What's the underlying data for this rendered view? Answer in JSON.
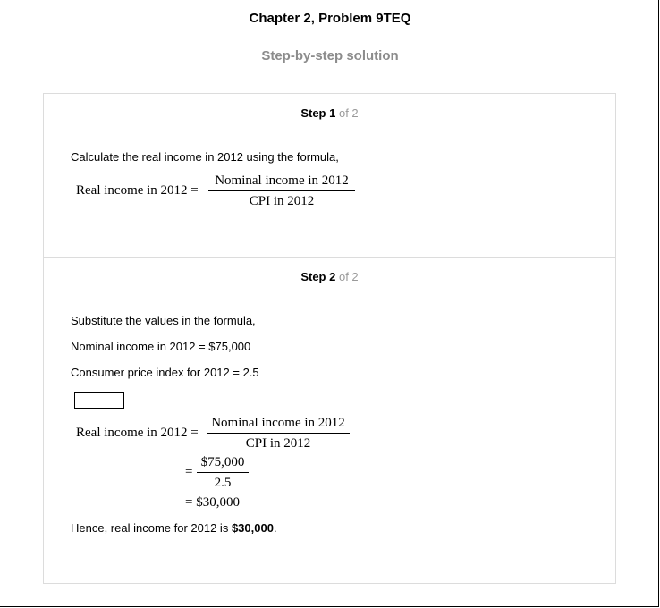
{
  "header": {
    "title": "Chapter 2, Problem 9TEQ",
    "subtitle": "Step-by-step solution"
  },
  "steps": [
    {
      "step_word": "Step 1",
      "of_text": "of 2",
      "intro": "Calculate the real income in 2012 using the formula,",
      "formula": {
        "lhs": "Real income in 2012 =",
        "numerator": "Nominal income in 2012",
        "denominator": "CPI in 2012"
      }
    },
    {
      "step_word": "Step 2",
      "of_text": "of 2",
      "lines": [
        "Substitute the values in the formula,",
        "Nominal income in 2012 = $75,000",
        "Consumer price index for 2012 = 2.5"
      ],
      "formula": {
        "lhs": "Real income in 2012 =",
        "numerator": "Nominal income in 2012",
        "denominator": "CPI in 2012",
        "eq1": "=",
        "sub_numerator": "$75,000",
        "sub_denominator": "2.5",
        "result": "= $30,000"
      },
      "conclusion_prefix": "Hence, real income for 2012 is ",
      "conclusion_value": "$30,000",
      "conclusion_suffix": "."
    }
  ]
}
